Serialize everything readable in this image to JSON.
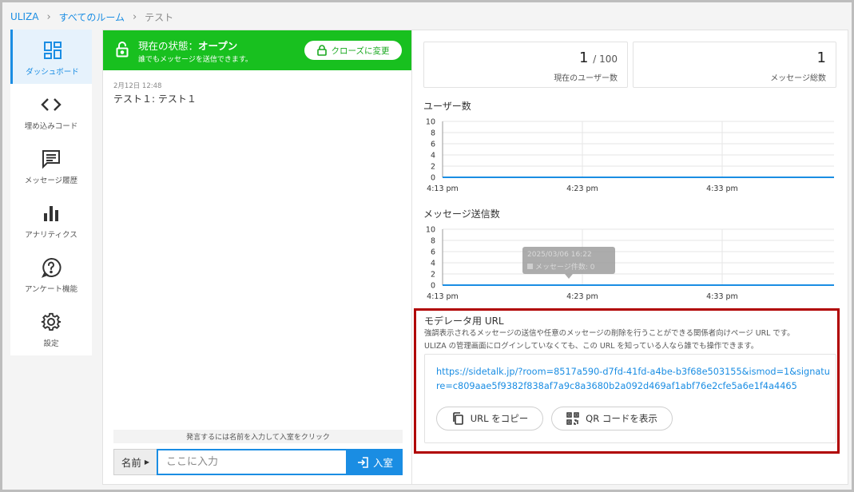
{
  "breadcrumb": {
    "root": "ULIZA",
    "rooms": "すべてのルーム",
    "current": "テスト"
  },
  "sidebar": {
    "items": [
      {
        "label": "ダッシュボード",
        "icon": "dashboard-icon"
      },
      {
        "label": "埋め込みコード",
        "icon": "code-icon"
      },
      {
        "label": "メッセージ履歴",
        "icon": "message-icon"
      },
      {
        "label": "アナリティクス",
        "icon": "analytics-icon"
      },
      {
        "label": "アンケート機能",
        "icon": "survey-icon"
      },
      {
        "label": "設定",
        "icon": "gear-icon"
      }
    ]
  },
  "status": {
    "prefix": "現在の状態：",
    "state": "オープン",
    "subtitle": "誰でもメッセージを送信できます。",
    "close_button": "クローズに変更",
    "color": "#18c01f"
  },
  "messages": [
    {
      "meta": "2月12日 12:48",
      "text": "テスト１: テスト１"
    }
  ],
  "composer": {
    "hint": "発言するには名前を入力して入室をクリック",
    "name_label": "名前",
    "placeholder": "ここに入力",
    "enter_button": "入室"
  },
  "stats": {
    "users_value": "1",
    "users_max": "/ 100",
    "users_label": "現在のユーザー数",
    "messages_value": "1",
    "messages_label": "メッセージ総数"
  },
  "chart_data": [
    {
      "type": "line",
      "title": "ユーザー数",
      "x": [
        "4:13 pm",
        "4:23 pm",
        "4:33 pm"
      ],
      "yticks": [
        "10",
        "8",
        "6",
        "4",
        "2",
        "0"
      ],
      "ylim": [
        0,
        10
      ],
      "series": [
        {
          "values": [
            0,
            0,
            0
          ]
        }
      ],
      "grid": true,
      "color": "#1a8de3"
    },
    {
      "type": "line",
      "title": "メッセージ送信数",
      "x": [
        "4:13 pm",
        "4:23 pm",
        "4:33 pm"
      ],
      "yticks": [
        "10",
        "8",
        "6",
        "4",
        "2",
        "0"
      ],
      "ylim": [
        0,
        10
      ],
      "series": [
        {
          "values": [
            0,
            0,
            0
          ]
        }
      ],
      "grid": true,
      "color": "#1a8de3",
      "tooltip": {
        "title": "2025/03/06 16:22",
        "label": "メッセージ件数: 0"
      }
    }
  ],
  "moderator": {
    "title": "モデレータ用 URL",
    "desc_line1": "強調表示されるメッセージの送信や任意のメッセージの削除を行うことができる関係者向けページ URL です。",
    "desc_line2": "ULIZA の管理画面にログインしていなくても、この URL を知っている人なら誰でも操作できます。",
    "url": "https://sidetalk.jp/?room=8517a590-d7fd-41fd-a4be-b3f68e503155&ismod=1&signature=c809aae5f9382f838af7a9c8a3680b2a092d469af1abf76e2cfe5a6e1f4a4465",
    "copy_button": "URL をコピー",
    "qr_button": "QR コードを表示"
  },
  "colors": {
    "accent": "#1a8de3",
    "open": "#18c01f",
    "highlight_border": "#b00000"
  }
}
